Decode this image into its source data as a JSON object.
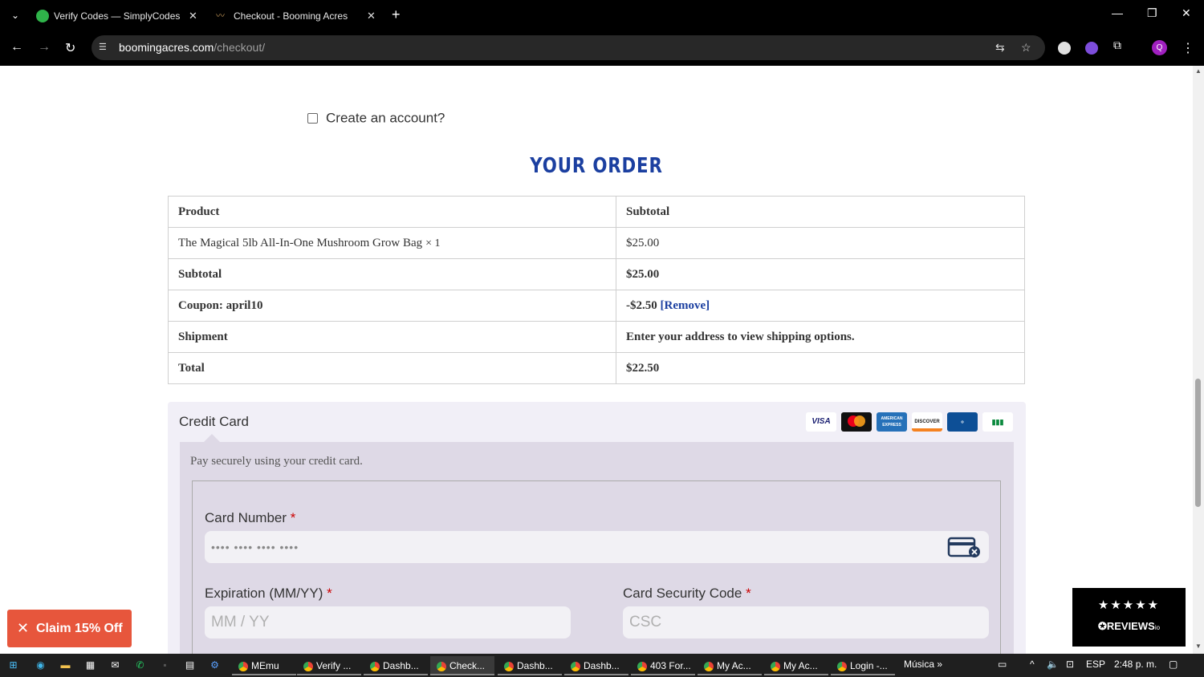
{
  "browser": {
    "tabs": [
      {
        "title": "Verify Codes — SimplyCodes",
        "favicon": "simplycodes-check-icon"
      },
      {
        "title": "Checkout - Booming Acres",
        "favicon": "booming-acres-icon"
      }
    ],
    "url_domain": "boomingacres.com",
    "url_path": "/checkout/",
    "profile_initial": "Q"
  },
  "checkout": {
    "create_account_label": "Create an account?",
    "order_title": "YOUR ORDER",
    "table": {
      "col_product": "Product",
      "col_subtotal": "Subtotal",
      "item_name": "The Magical 5lb All-In-One Mushroom Grow Bag",
      "item_qty": "× 1",
      "item_price": "$25.00",
      "subtotal_label": "Subtotal",
      "subtotal_value": "$25.00",
      "coupon_label": "Coupon: april10",
      "coupon_value": "-$2.50",
      "coupon_remove": "[Remove]",
      "shipment_label": "Shipment",
      "shipment_value": "Enter your address to view shipping options.",
      "total_label": "Total",
      "total_value": "$22.50"
    },
    "payment": {
      "method_label": "Credit Card",
      "description": "Pay securely using your credit card.",
      "card_number_label": "Card Number",
      "card_number_placeholder": "•••• •••• •••• ••••",
      "expiration_label": "Expiration (MM/YY)",
      "expiration_placeholder": "MM / YY",
      "csc_label": "Card Security Code",
      "csc_placeholder": "CSC",
      "required_mark": "*",
      "card_brands": [
        "VISA",
        "mastercard",
        "AMERICAN EXPRESS",
        "DISCOVER",
        "Diners Club",
        "JCB"
      ]
    }
  },
  "widgets": {
    "claim_label": "Claim 15% Off",
    "reviews_stars": "★★★★★",
    "reviews_brand": "REVIEWS",
    "reviews_suffix": "io"
  },
  "taskbar": {
    "apps": [
      "MEmu",
      "Verify ...",
      "Dashb...",
      "Check...",
      "Dashb...",
      "Dashb...",
      "403 For...",
      "My Ac...",
      "My Ac...",
      "Login -..."
    ],
    "music_label": "Música",
    "language": "ESP",
    "time": "2:48 p. m."
  },
  "colors": {
    "accent_blue": "#1b3fa0",
    "claim_orange": "#e7563c",
    "payment_bg": "#ded9e6"
  }
}
